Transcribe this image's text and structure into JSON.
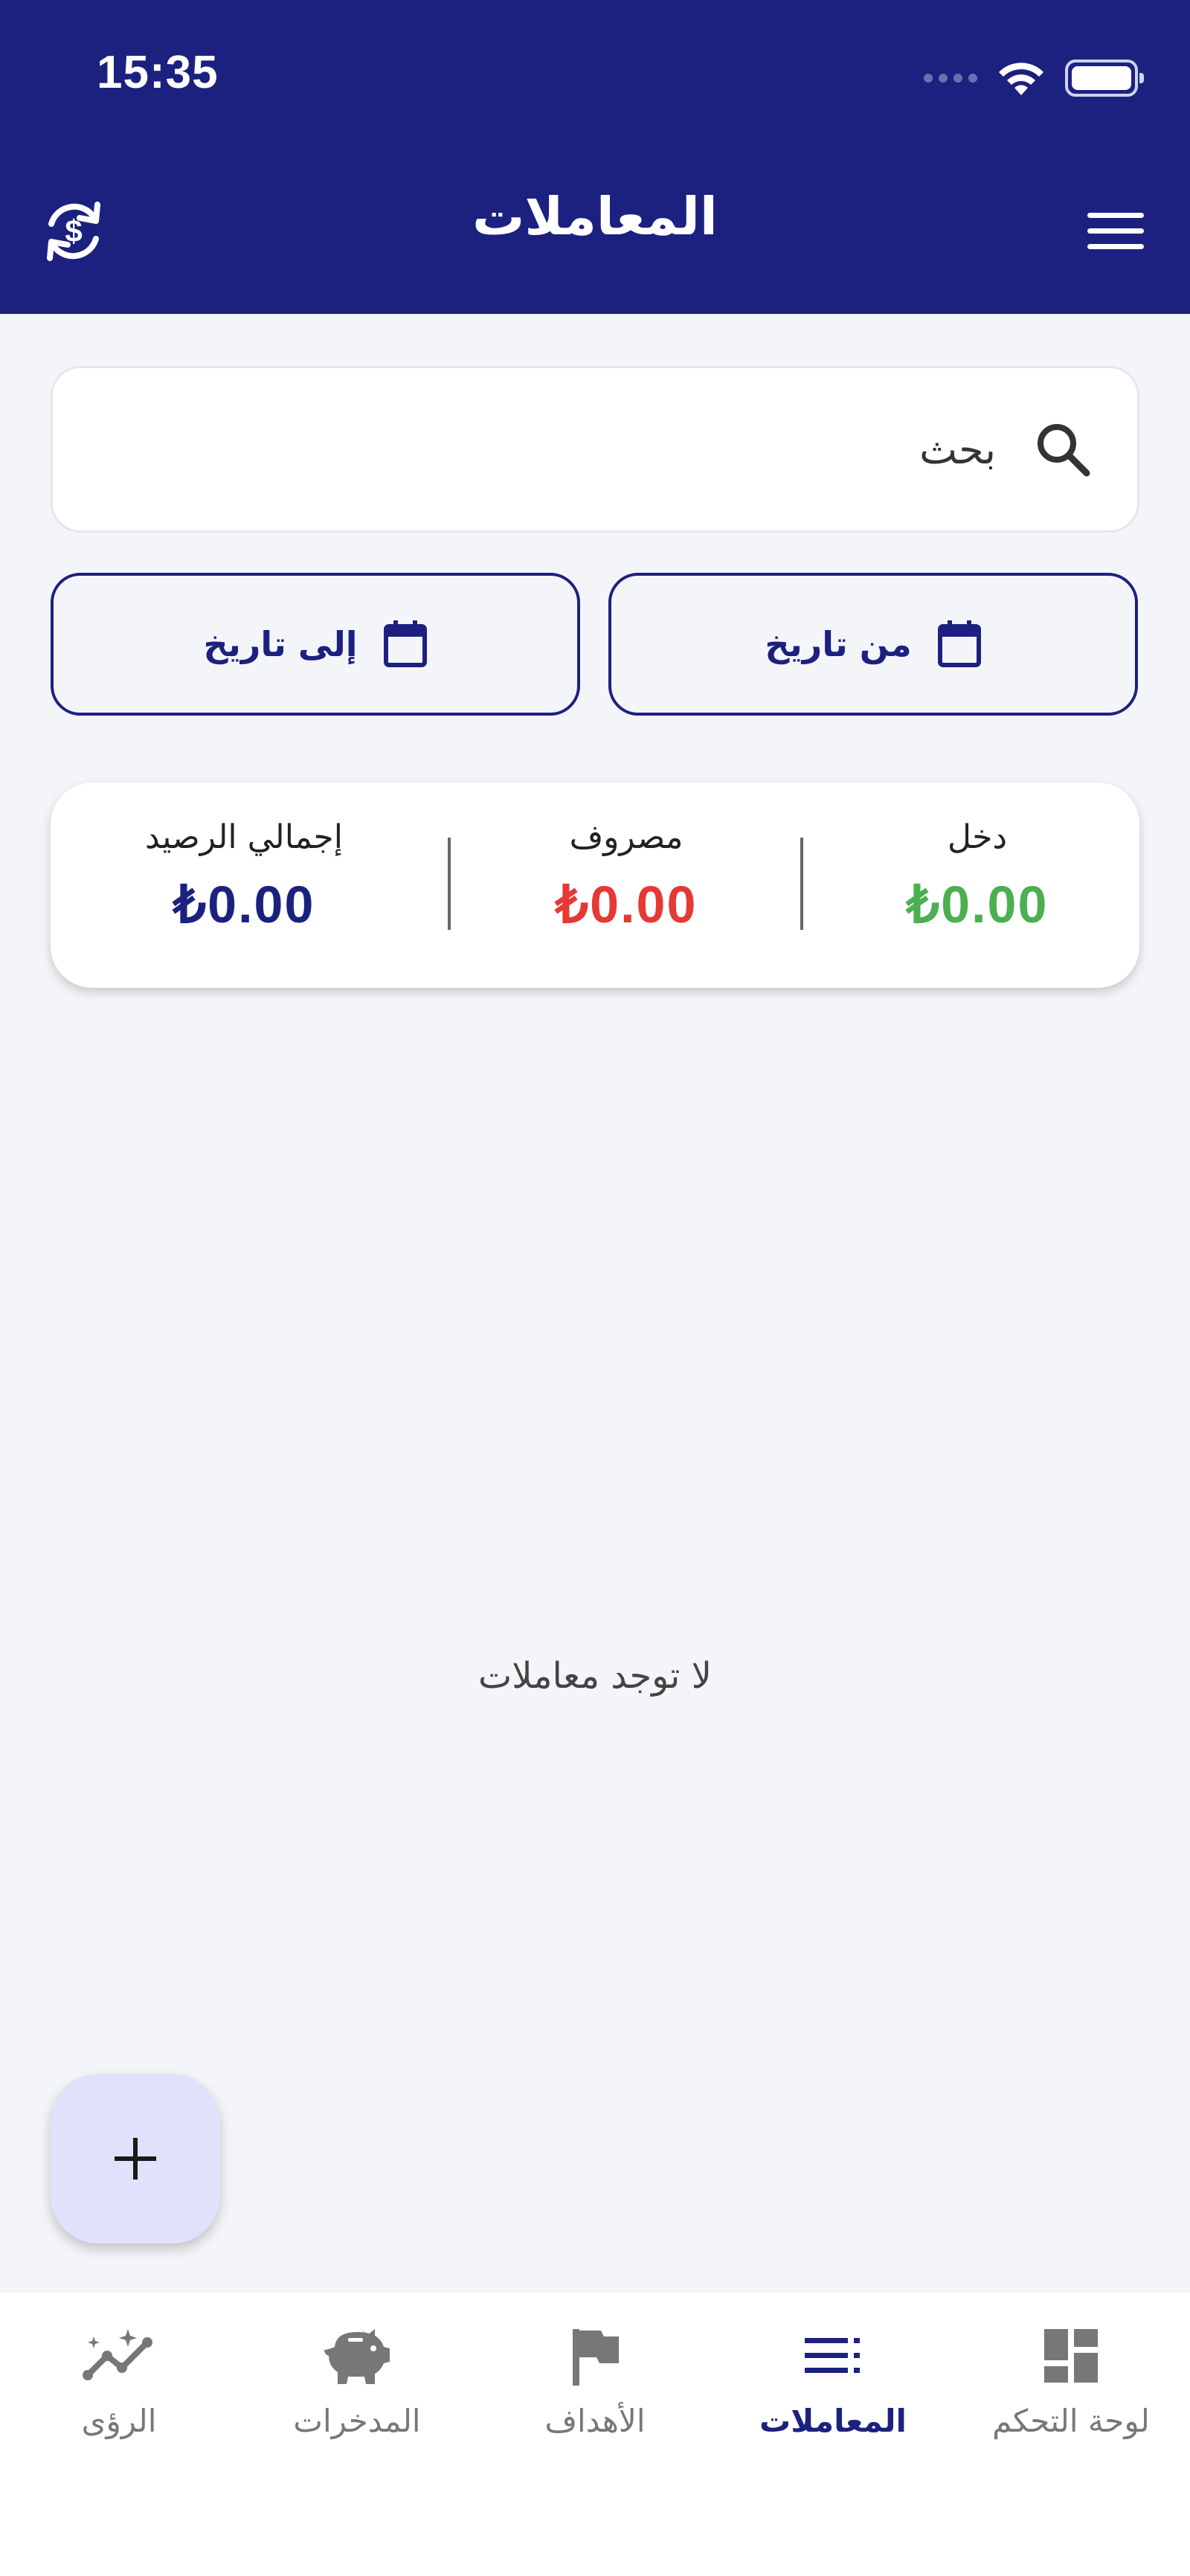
{
  "status_bar": {
    "time": "15:35"
  },
  "header": {
    "title": "المعاملات",
    "left_icon": "currency-sync-icon",
    "right_icon": "menu-icon"
  },
  "search": {
    "placeholder": "بحث",
    "value": ""
  },
  "date_filters": {
    "from_label": "من تاريخ",
    "to_label": "إلى تاريخ"
  },
  "summary": {
    "income_label": "دخل",
    "income_value": "₺0.00",
    "expense_label": "مصروف",
    "expense_value": "₺0.00",
    "total_label": "إجمالي الرصيد",
    "total_value": "₺0.00"
  },
  "empty_state": "لا توجد معاملات",
  "fab": {
    "icon": "plus-icon"
  },
  "bottom_nav": {
    "items": [
      {
        "label": "الرؤى",
        "icon": "insights-icon",
        "active": false
      },
      {
        "label": "المدخرات",
        "icon": "piggy-bank-icon",
        "active": false
      },
      {
        "label": "الأهداف",
        "icon": "flag-icon",
        "active": false
      },
      {
        "label": "المعاملات",
        "icon": "list-icon",
        "active": true
      },
      {
        "label": "لوحة التحكم",
        "icon": "dashboard-icon",
        "active": false
      }
    ]
  },
  "colors": {
    "primary": "#1c2180",
    "income": "#4caf50",
    "expense": "#e53935",
    "background": "#f4f5f9",
    "fab_bg": "#e0e1fb"
  }
}
